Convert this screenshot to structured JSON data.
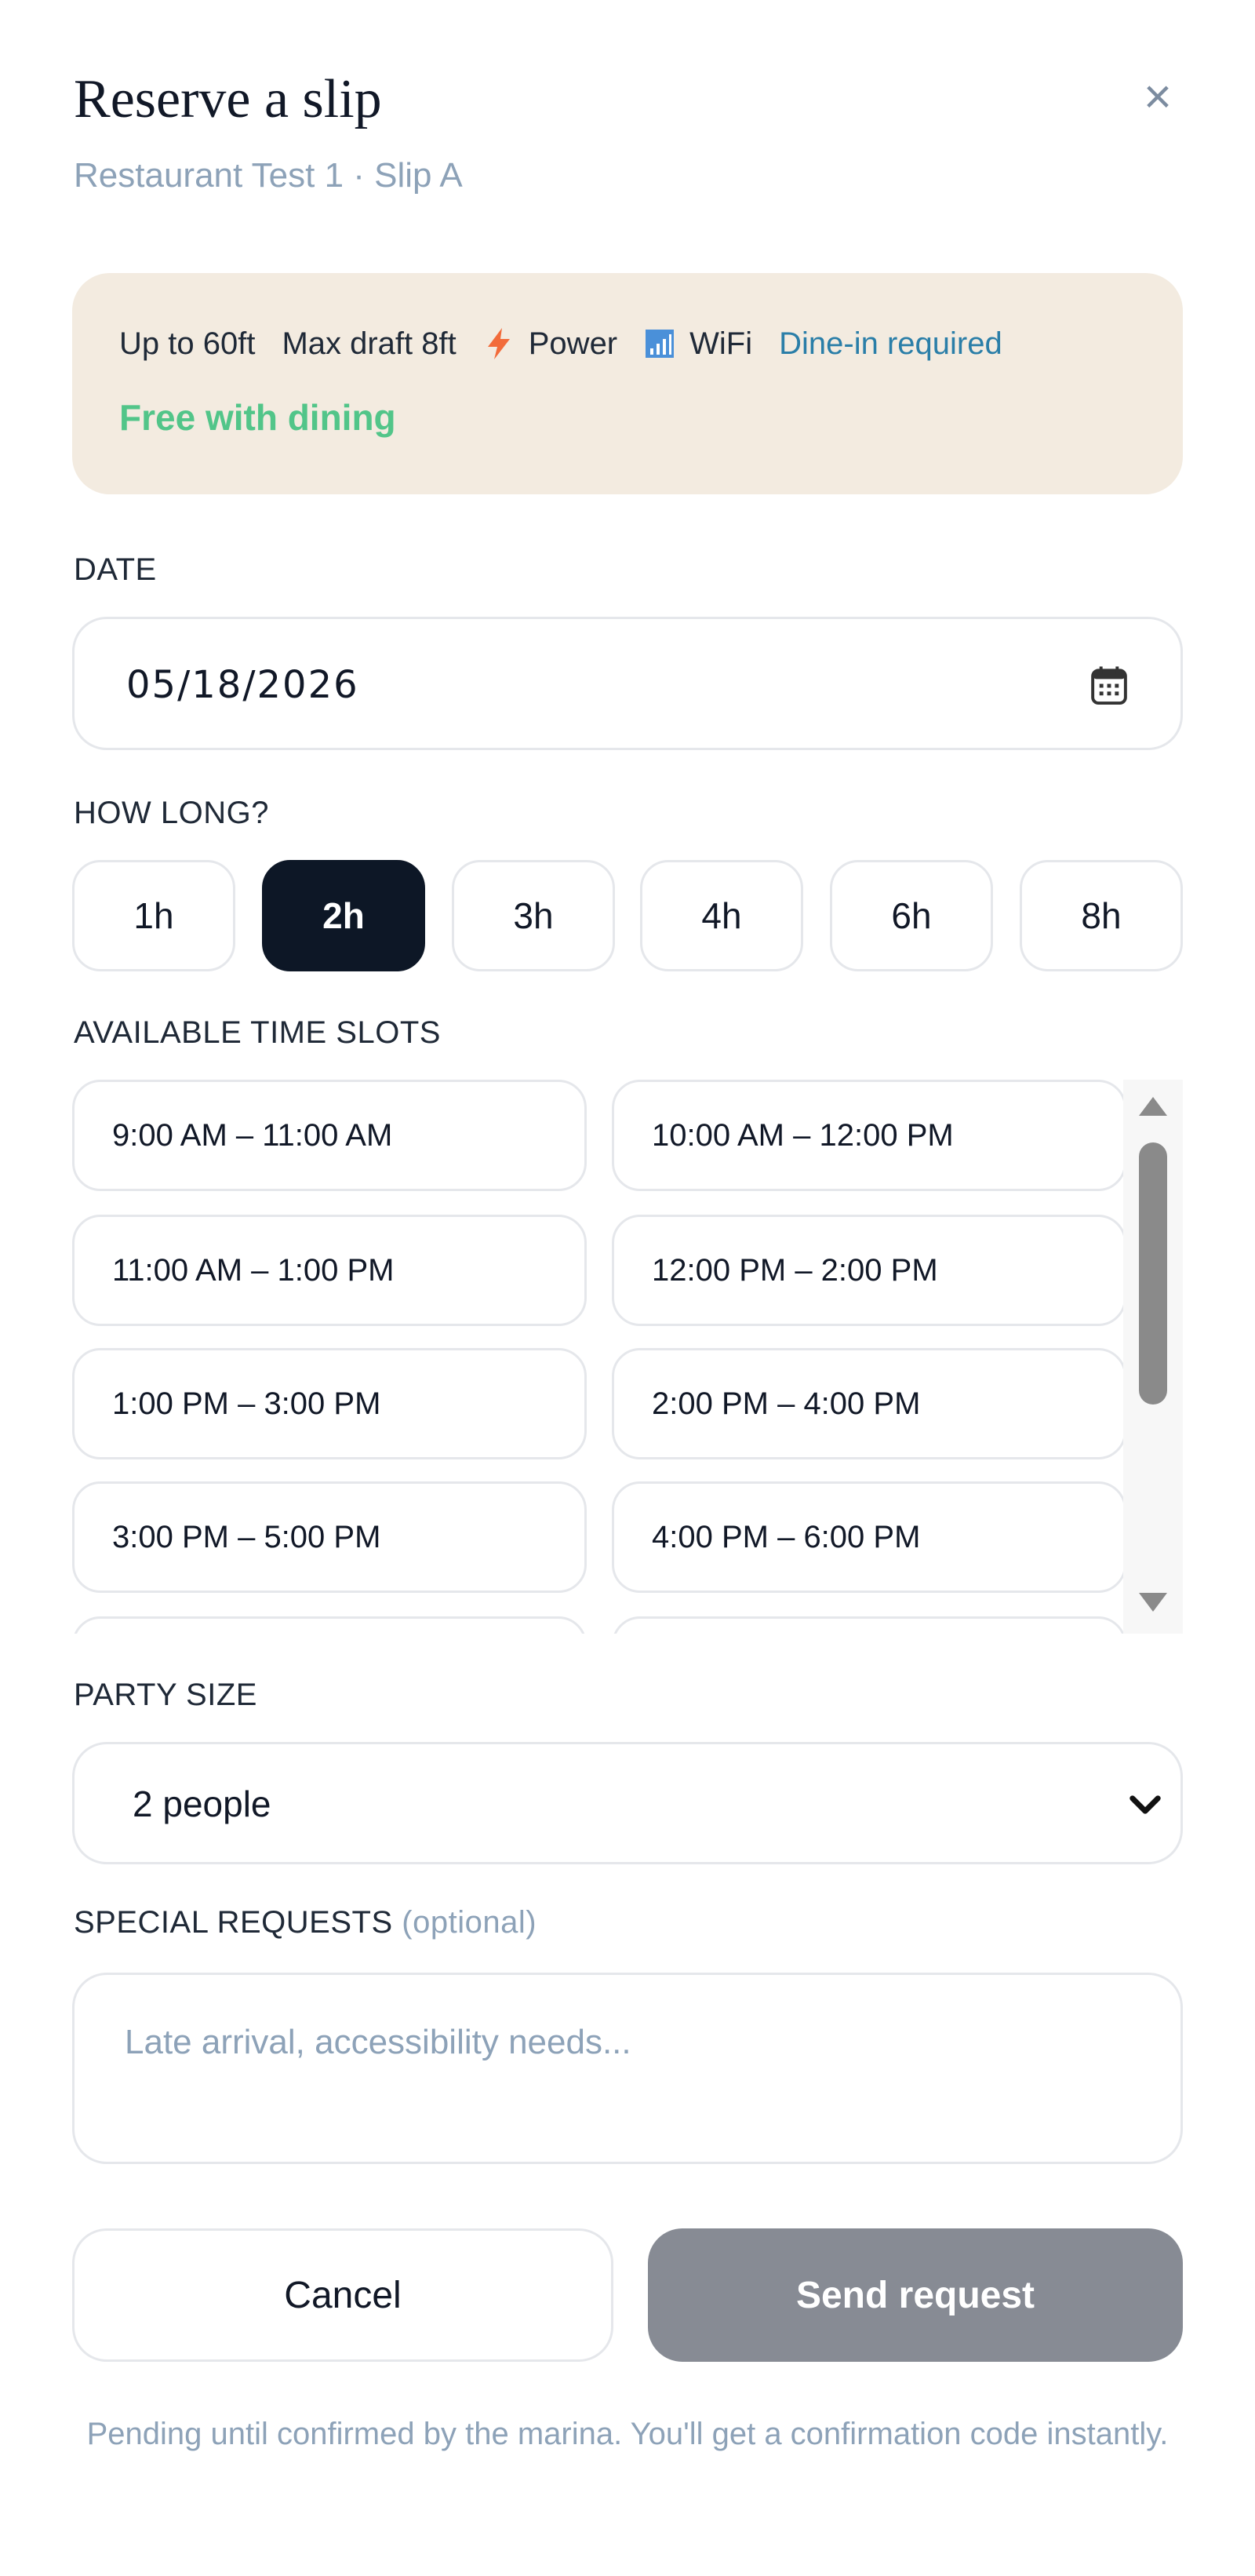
{
  "header": {
    "title": "Reserve a slip",
    "subtitle": "Restaurant Test 1 · Slip A",
    "close_label": "×"
  },
  "slip_info": {
    "length": "Up to 60ft",
    "draft": "Max draft 8ft",
    "power": "Power",
    "wifi": "WiFi",
    "dine_in": "Dine-in required",
    "price_note": "Free with dining",
    "icons": [
      "lightning-icon",
      "wifi-signal-icon"
    ]
  },
  "date": {
    "label": "DATE",
    "value": "05/18/2026",
    "icon": "calendar-icon"
  },
  "duration": {
    "label": "HOW LONG?",
    "options": [
      "1h",
      "2h",
      "3h",
      "4h",
      "6h",
      "8h"
    ],
    "selected": "2h"
  },
  "time_slots": {
    "label": "AVAILABLE TIME SLOTS",
    "slots": [
      "9:00 AM – 11:00 AM",
      "10:00 AM – 12:00 PM",
      "11:00 AM – 1:00 PM",
      "12:00 PM – 2:00 PM",
      "1:00 PM – 3:00 PM",
      "2:00 PM – 4:00 PM",
      "3:00 PM – 5:00 PM",
      "4:00 PM – 6:00 PM"
    ]
  },
  "party_size": {
    "label": "PARTY SIZE",
    "value": "2 people"
  },
  "special_requests": {
    "label": "SPECIAL REQUESTS",
    "optional": "(optional)",
    "placeholder": "Late arrival, accessibility needs..."
  },
  "actions": {
    "cancel": "Cancel",
    "submit": "Send request"
  },
  "footnote": "Pending until confirmed by the marina. You'll get a confirmation code instantly.",
  "colors": {
    "accent_dark": "#0d1726",
    "muted_text": "#8da2b8",
    "success": "#52c589",
    "card_bg": "#f3ebe0",
    "link": "#2a7ea8",
    "disabled_button": "#878b94"
  }
}
